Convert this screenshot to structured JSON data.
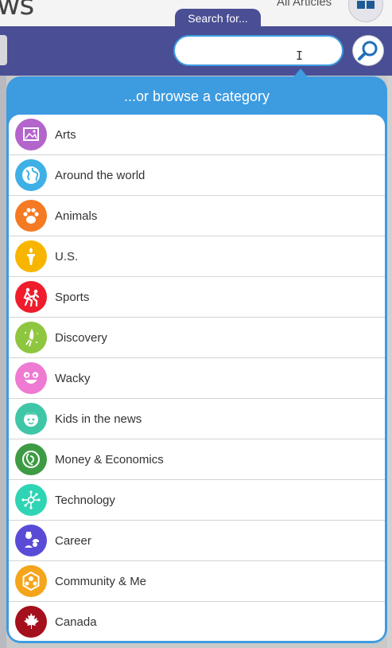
{
  "header": {
    "logo_fragment": "ws",
    "all_articles_label": "All Articles"
  },
  "search": {
    "tab_label": "Search for...",
    "value": "",
    "placeholder": ""
  },
  "dropdown": {
    "title": "...or browse a category",
    "categories": [
      {
        "label": "Arts",
        "icon": "arts-icon",
        "color": "#b365cb"
      },
      {
        "label": "Around the world",
        "icon": "globe-icon",
        "color": "#3fb0e5"
      },
      {
        "label": "Animals",
        "icon": "paw-icon",
        "color": "#f47a23"
      },
      {
        "label": "U.S.",
        "icon": "torch-icon",
        "color": "#f7b500"
      },
      {
        "label": "Sports",
        "icon": "runner-icon",
        "color": "#ef1c2c"
      },
      {
        "label": "Discovery",
        "icon": "rocket-icon",
        "color": "#8fc63f"
      },
      {
        "label": "Wacky",
        "icon": "smiley-icon",
        "color": "#ee7ad2"
      },
      {
        "label": "Kids in the news",
        "icon": "kid-face-icon",
        "color": "#3fc6a7"
      },
      {
        "label": "Money & Economics",
        "icon": "coin-icon",
        "color": "#3e9b45"
      },
      {
        "label": "Technology",
        "icon": "circuit-icon",
        "color": "#2fd4b4"
      },
      {
        "label": "Career",
        "icon": "career-icon",
        "color": "#5a4bd6"
      },
      {
        "label": "Community & Me",
        "icon": "community-icon",
        "color": "#f4a51b"
      },
      {
        "label": "Canada",
        "icon": "maple-leaf-icon",
        "color": "#a4101c"
      }
    ]
  }
}
